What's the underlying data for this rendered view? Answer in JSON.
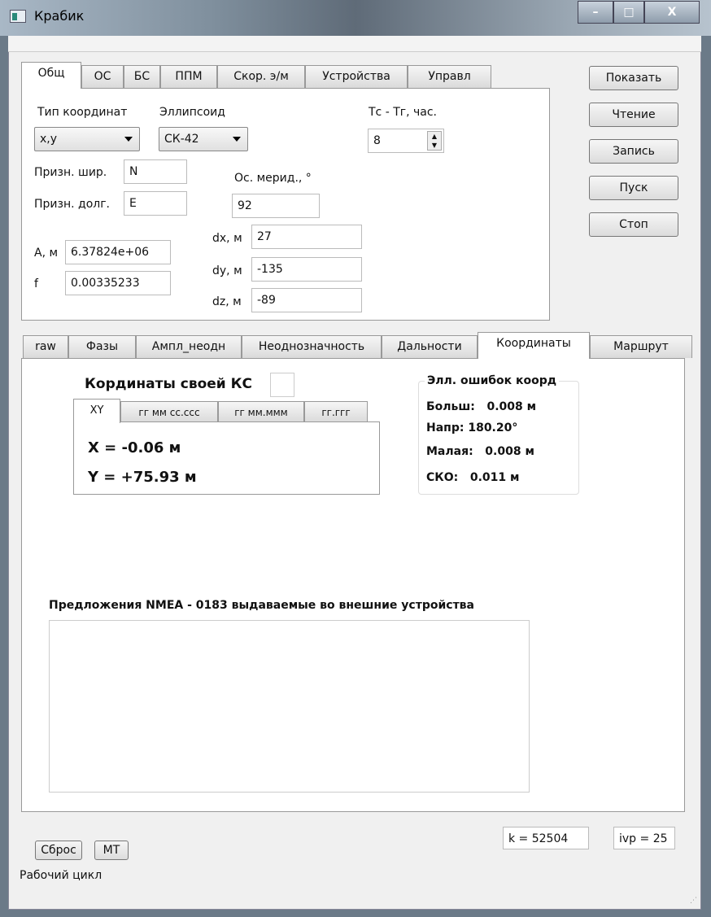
{
  "window": {
    "title": "Крабик",
    "min": "–",
    "max": "□",
    "close": "X"
  },
  "top_tabs": [
    "Общ",
    "ОС",
    "БС",
    "ППМ",
    "Скор. э/м",
    "Устройства",
    "Управл"
  ],
  "general": {
    "coord_type_label": "Тип координат",
    "coord_type_value": "x,y",
    "ellipsoid_label": "Эллипсоид",
    "ellipsoid_value": "СК-42",
    "tz_label": "Тс - Тг, час.",
    "tz_value": "8",
    "lat_sign_label": "Призн. шир.",
    "lat_sign_value": "N",
    "lon_sign_label": "Призн. долг.",
    "lon_sign_value": "E",
    "meridian_label": "Ос. мерид., °",
    "meridian_value": "92",
    "a_label": "A, м",
    "a_value": "6.37824e+06",
    "f_label": "f",
    "f_value": "0.00335233",
    "dx_label": "dx, м",
    "dx_value": "27",
    "dy_label": "dy, м",
    "dy_value": "-135",
    "dz_label": "dz, м",
    "dz_value": "-89"
  },
  "side_buttons": [
    "Показать",
    "Чтение",
    "Запись",
    "Пуск",
    "Стоп"
  ],
  "bottom_tabs": [
    "raw",
    "Фазы",
    "Ампл_неодн",
    "Неоднозначность",
    "Дальности",
    "Координаты",
    "Маршрут"
  ],
  "coords": {
    "title": "Кординаты своей КС",
    "sub_tabs": [
      "XY",
      "гг мм сс.ссс",
      "гг мм.ммм",
      "гг.ггг"
    ],
    "x": "X = -0.06 м",
    "y": "Y = +75.93 м",
    "ellipse_title": "Элл. ошибок коорд",
    "major": "Больш:   0.008 м",
    "dir": "Напр: 180.20°",
    "minor": "Малая:   0.008 м",
    "rms": "СКО:   0.011 м"
  },
  "nmea": {
    "title": "Предложения NMEA - 0183 выдаваемые во внешние устройства",
    "text": ""
  },
  "footer": {
    "reset": "Сброс",
    "mt": "МТ",
    "k": "k = 52504",
    "ivp": "ivp = 25",
    "status": "Рабочий цикл"
  }
}
